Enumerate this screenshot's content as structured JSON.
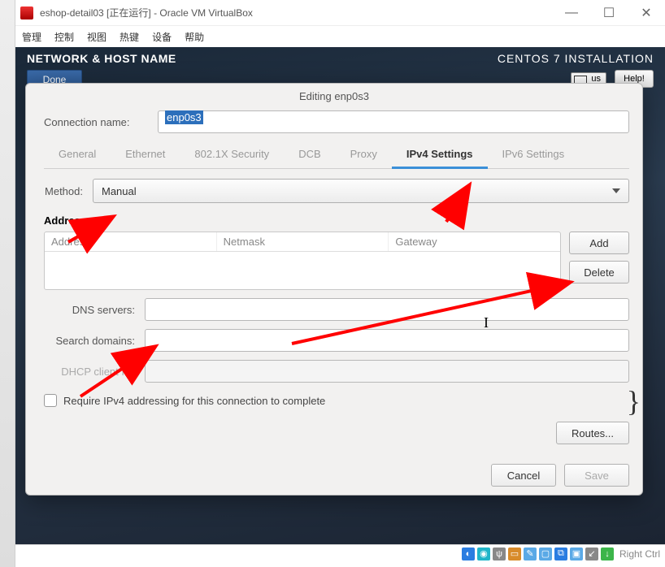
{
  "vb": {
    "title": "eshop-detail03 [正在运行] - Oracle VM VirtualBox",
    "menu": [
      "管理",
      "控制",
      "视图",
      "热键",
      "设备",
      "帮助"
    ],
    "host_key": "Right Ctrl"
  },
  "installer": {
    "section": "NETWORK & HOST NAME",
    "product": "CENTOS 7 INSTALLATION",
    "keyboard": "us",
    "done": "Done",
    "help": "Help!"
  },
  "dialog": {
    "title": "Editing enp0s3",
    "conn_label": "Connection name:",
    "conn_value": "enp0s3",
    "tabs": [
      "General",
      "Ethernet",
      "802.1X Security",
      "DCB",
      "Proxy",
      "IPv4 Settings",
      "IPv6 Settings"
    ],
    "active_tab": "IPv4 Settings",
    "method_label": "Method:",
    "method_value": "Manual",
    "addresses_title": "Addresses",
    "addr_cols": {
      "addr": "Address",
      "mask": "Netmask",
      "gw": "Gateway"
    },
    "add": "Add",
    "delete": "Delete",
    "dns_label": "DNS servers:",
    "search_label": "Search domains:",
    "dhcp_label": "DHCP client ID:",
    "require": "Require IPv4 addressing for this connection to complete",
    "routes": "Routes...",
    "cancel": "Cancel",
    "save": "Save"
  },
  "status_icons": [
    "disk",
    "optical",
    "usb",
    "folder",
    "clipboard",
    "monitor",
    "net",
    "record",
    "mouse",
    "power"
  ]
}
